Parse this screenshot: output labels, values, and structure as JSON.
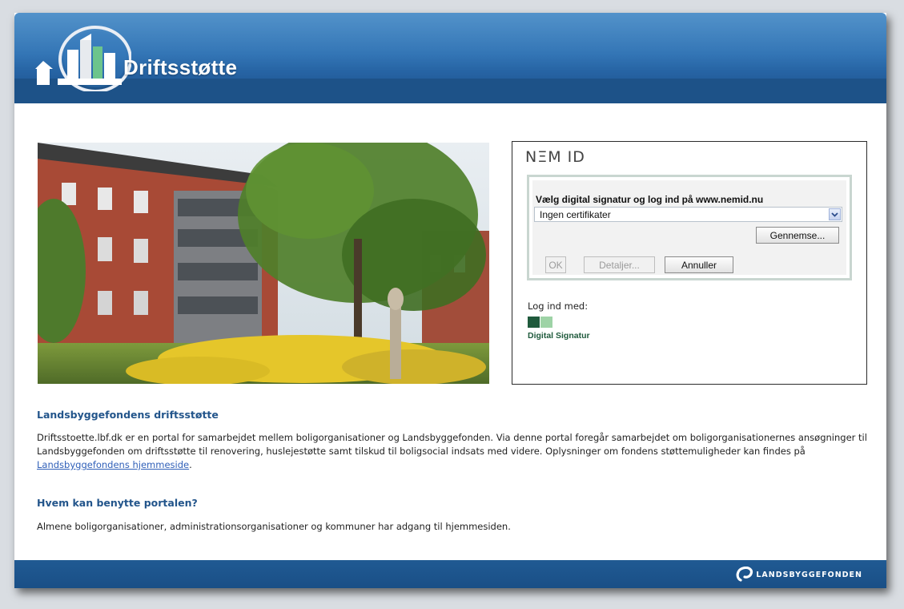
{
  "header": {
    "brand": "Driftsstøtte"
  },
  "nemid": {
    "title": "NΞM ID",
    "applet_heading": "Vælg digital signatur og log ind på www.nemid.nu",
    "certificate_select_value": "Ingen certifikater",
    "browse_label": "Gennemse...",
    "ok_label": "OK",
    "details_label": "Detaljer...",
    "cancel_label": "Annuller",
    "login_with_label": "Log ind med:",
    "digital_signature_label": "Digital Signatur"
  },
  "content": {
    "section1_title": "Landsbyggefondens driftsstøtte",
    "section1_text": "Driftsstoette.lbf.dk er en portal for samarbejdet mellem boligorganisationer og Landsbyggefonden. Via denne portal foregår samarbejdet om boligorganisationernes ansøgninger til Landsbyggefonden om driftsstøtte til renovering, huslejestøtte samt tilskud til boligsocial indsats med videre. Oplysninger om fondens støttemuligheder kan findes på",
    "section1_link": "Landsbyggefondens hjemmeside",
    "section1_end": ".",
    "section2_title": "Hvem kan benytte portalen?",
    "section2_text": "Almene boligorganisationer, administrationsorganisationer og kommuner har adgang til hjemmesiden."
  },
  "footer": {
    "logo_text": "LANDSBYGGEFONDEN"
  },
  "colors": {
    "header_blue": "#2e72b4",
    "band_blue": "#1d5288",
    "heading_blue": "#23558b",
    "link_blue": "#2f5fb8",
    "nemid_green": "#1f5a3c"
  },
  "icons": {
    "brand_logo": "building-circle-logo-icon",
    "select_arrow": "chevron-down-icon",
    "digital_signature": "digital-signature-logo-icon",
    "footer_logo": "landsbyggefonden-swirl-icon"
  }
}
